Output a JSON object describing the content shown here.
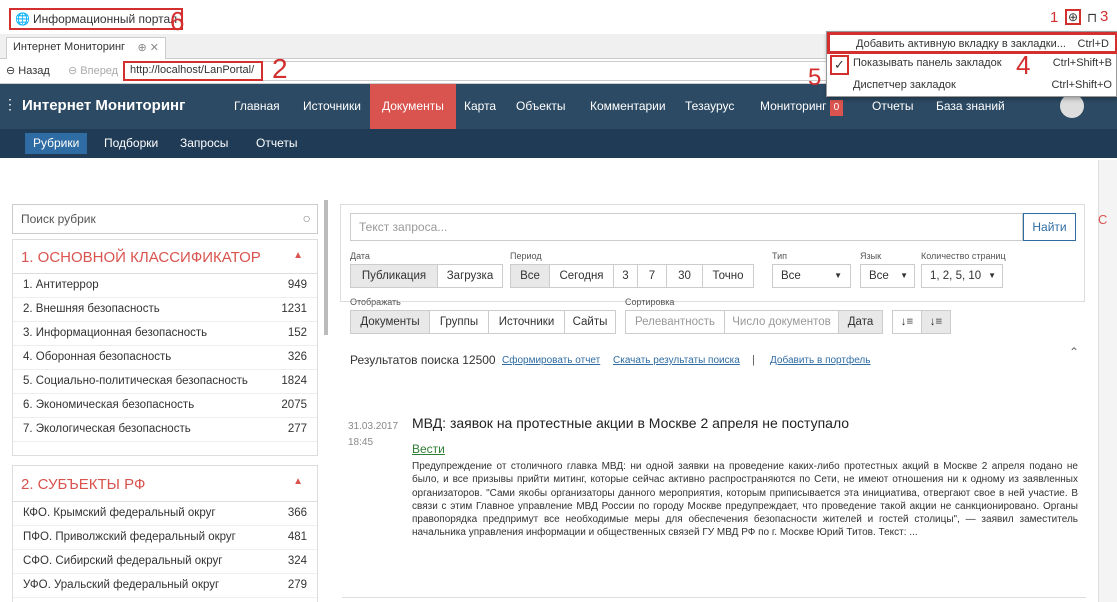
{
  "bookmarks_bar": {
    "item": "Информационный портал"
  },
  "annotations": {
    "n1": "1",
    "n2": "2",
    "n3": "3",
    "n4": "4",
    "n5": "5",
    "n6": "6"
  },
  "tab": {
    "title": "Интернет Мониторинг"
  },
  "nav": {
    "back": "Назад",
    "forward": "Вперед",
    "url": "http://localhost/LanPortal/"
  },
  "bookmark_menu": {
    "items": [
      {
        "label": "Добавить активную вкладку в закладки...",
        "shortcut": "Ctrl+D"
      },
      {
        "label": "Показывать панель закладок",
        "shortcut": "Ctrl+Shift+B",
        "checked": true
      },
      {
        "label": "Диспетчер закладок",
        "shortcut": "Ctrl+Shift+O"
      }
    ]
  },
  "header": {
    "logo": "Интернет Мониторинг",
    "menu": [
      "Главная",
      "Источники",
      "Документы",
      "Карта",
      "Объекты",
      "Комментарии",
      "Тезаурус",
      "Мониторинг",
      "Отчеты",
      "База знаний"
    ],
    "monitoring_badge": "0",
    "active": "Документы"
  },
  "subnav": {
    "items": [
      "Рубрики",
      "Подборки",
      "Запросы",
      "Отчеты"
    ]
  },
  "left": {
    "search_placeholder": "Поиск рубрик",
    "groups": [
      {
        "title": "1. ОСНОВНОЙ КЛАССИФИКАТОР",
        "rows": [
          {
            "name": "1. Антитеррор",
            "count": "949"
          },
          {
            "name": "2. Внешняя безопасность",
            "count": "1231"
          },
          {
            "name": "3. Информационная безопасность",
            "count": "152"
          },
          {
            "name": "4. Оборонная безопасность",
            "count": "326"
          },
          {
            "name": "5. Социально-политическая безопасность",
            "count": "1824"
          },
          {
            "name": "6. Экономическая безопасность",
            "count": "2075"
          },
          {
            "name": "7. Экологическая безопасность",
            "count": "277"
          }
        ]
      },
      {
        "title": "2. СУБЪЕКТЫ РФ",
        "rows": [
          {
            "name": "КФО. Крымский федеральный округ",
            "count": "366"
          },
          {
            "name": "ПФО. Приволжский федеральный округ",
            "count": "481"
          },
          {
            "name": "СФО. Сибирский федеральный округ",
            "count": "324"
          },
          {
            "name": "УФО. Уральский федеральный округ",
            "count": "279"
          }
        ]
      }
    ]
  },
  "search": {
    "placeholder": "Текст запроса...",
    "find": "Найти",
    "labels": {
      "date": "Дата",
      "period": "Период",
      "type": "Тип",
      "lang": "Язык",
      "pages": "Количество страниц",
      "show": "Отображать",
      "sort": "Сортировка"
    },
    "date_btns": [
      "Публикация",
      "Загрузка"
    ],
    "period_btns": [
      "Все",
      "Сегодня",
      "3",
      "7",
      "30",
      "Точно"
    ],
    "type_val": "Все",
    "lang_val": "Все",
    "pages_val": "1, 2, 5, 10",
    "show_btns": [
      "Документы",
      "Группы",
      "Источники",
      "Сайты"
    ],
    "sort_btns": [
      "Релевантность",
      "Число документов",
      "Дата"
    ]
  },
  "results": {
    "count": "Результатов поиска 12500",
    "links": [
      "Сформировать отчет",
      "Скачать результаты поиска",
      "Добавить в портфель"
    ],
    "sep": "|"
  },
  "article": {
    "date": "31.03.2017",
    "time": "18:45",
    "title": "МВД: заявок на протестные акции в Москве 2 апреля не поступало",
    "source": "Вести",
    "body": "Предупреждение от столичного главка МВД: ни одной заявки на проведение каких-либо протестных акций в Москве 2 апреля подано не было, и все призывы прийти митинг, которые сейчас активно распространяются по Сети, не имеют отношения ни к одному из заявленных организаторов. \"Сами якобы организаторы данного мероприятия, которым приписывается эта инициатива, отвергают свое в ней участие. В связи с этим Главное управление МВД России по городу Москве предупреждает, что проведение такой акции не санкционировано. Органы правопорядка предпримут все необходимые меры для обеспечения безопасности жителей и гостей столицы\", — заявил заместитель начальника управления информации и общественных связей ГУ МВД РФ по г. Москве Юрий Титов. Текст: ..."
  },
  "right_edge_label": "С"
}
